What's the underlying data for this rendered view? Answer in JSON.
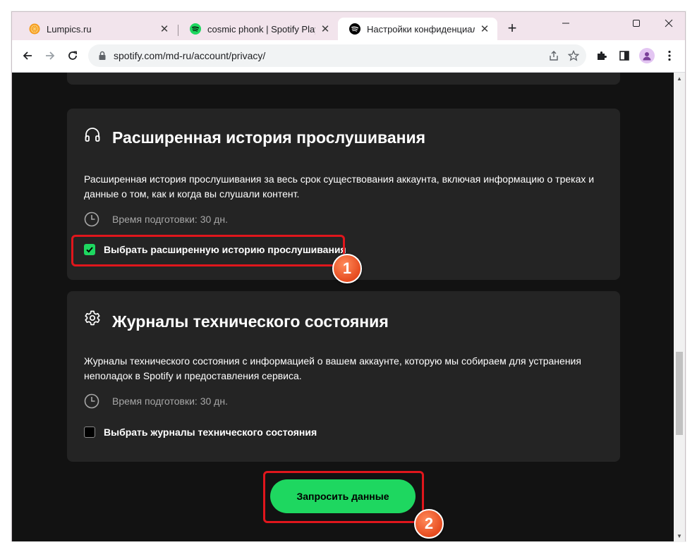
{
  "browser": {
    "tabs": [
      {
        "title": "Lumpics.ru",
        "favicon": "orange-icon",
        "active": false
      },
      {
        "title": "cosmic phonk | Spotify Playlist",
        "favicon": "spotify-icon",
        "active": false
      },
      {
        "title": "Настройки конфиденциальности",
        "favicon": "spotify-icon",
        "active": true
      }
    ],
    "new_tab_label": "+",
    "url": "spotify.com/md-ru/account/privacy/",
    "window_controls": [
      "minimize-icon",
      "maximize-icon",
      "close-icon"
    ],
    "nav_icons": [
      "back-arrow-icon",
      "forward-arrow-icon",
      "reload-icon"
    ],
    "toolbar_icons": [
      "share-icon",
      "bookmark-star-icon",
      "extensions-icon",
      "side-panel-icon",
      "profile-avatar-icon",
      "menu-icon"
    ]
  },
  "cards": [
    {
      "icon": "headphones-icon",
      "title": "Расширенная история прослушивания",
      "description": "Расширенная история прослушивания за весь срок существования аккаунта, включая информацию о треках и данные о том, как и когда вы слушали контент.",
      "prep_time": "Время подготовки: 30 дн.",
      "checkbox_label": "Выбрать расширенную историю прослушивания",
      "checked": true
    },
    {
      "icon": "gear-icon",
      "title": "Журналы технического состояния",
      "description": "Журналы технического состояния с информацией о вашем аккаунте, которую мы собираем для устранения неполадок в Spotify и предоставления сервиса.",
      "prep_time": "Время подготовки: 30 дн.",
      "checkbox_label": "Выбрать журналы технического состояния",
      "checked": false
    }
  ],
  "request_button": "Запросить данные",
  "annotations": [
    "1",
    "2"
  ],
  "colors": {
    "accent": "#1ed760",
    "page_bg": "#121212",
    "card_bg": "#242424",
    "highlight": "#e0161c",
    "badge": "#e64b1f"
  }
}
